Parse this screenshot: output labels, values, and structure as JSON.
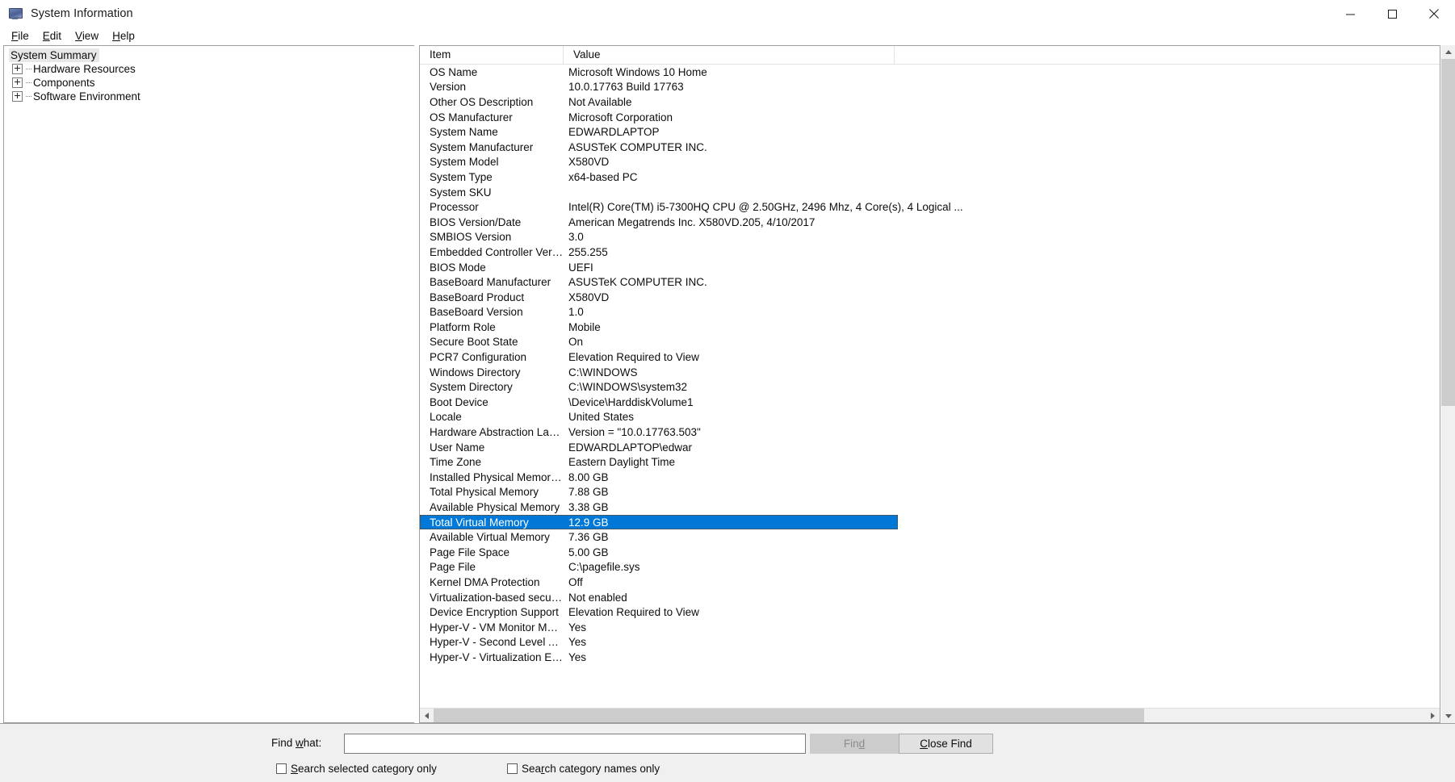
{
  "window": {
    "title": "System Information",
    "icon": "system-information-icon",
    "controls": {
      "minimize": "minimize-icon",
      "maximize": "maximize-icon",
      "close": "close-icon"
    }
  },
  "menubar": {
    "items": [
      {
        "label": "File",
        "accel": "F",
        "rest": "ile"
      },
      {
        "label": "Edit",
        "accel": "E",
        "rest": "dit"
      },
      {
        "label": "View",
        "accel": "V",
        "rest": "iew"
      },
      {
        "label": "Help",
        "accel": "H",
        "rest": "elp"
      }
    ]
  },
  "tree": {
    "selected": "System Summary",
    "nodes": [
      {
        "label": "System Summary",
        "expandable": false,
        "selected": true
      },
      {
        "label": "Hardware Resources",
        "expandable": true,
        "selected": false
      },
      {
        "label": "Components",
        "expandable": true,
        "selected": false
      },
      {
        "label": "Software Environment",
        "expandable": true,
        "selected": false
      }
    ]
  },
  "list": {
    "columns": [
      "Item",
      "Value"
    ],
    "selected_index": 30,
    "rows": [
      {
        "item": "OS Name",
        "value": "Microsoft Windows 10 Home"
      },
      {
        "item": "Version",
        "value": "10.0.17763 Build 17763"
      },
      {
        "item": "Other OS Description",
        "value": "Not Available"
      },
      {
        "item": "OS Manufacturer",
        "value": "Microsoft Corporation"
      },
      {
        "item": "System Name",
        "value": "EDWARDLAPTOP"
      },
      {
        "item": "System Manufacturer",
        "value": "ASUSTeK COMPUTER INC."
      },
      {
        "item": "System Model",
        "value": "X580VD"
      },
      {
        "item": "System Type",
        "value": "x64-based PC"
      },
      {
        "item": "System SKU",
        "value": ""
      },
      {
        "item": "Processor",
        "value": "Intel(R) Core(TM) i5-7300HQ CPU @ 2.50GHz, 2496 Mhz, 4 Core(s), 4 Logical ..."
      },
      {
        "item": "BIOS Version/Date",
        "value": "American Megatrends Inc. X580VD.205, 4/10/2017"
      },
      {
        "item": "SMBIOS Version",
        "value": "3.0"
      },
      {
        "item": "Embedded Controller Version",
        "value": "255.255"
      },
      {
        "item": "BIOS Mode",
        "value": "UEFI"
      },
      {
        "item": "BaseBoard Manufacturer",
        "value": "ASUSTeK COMPUTER INC."
      },
      {
        "item": "BaseBoard Product",
        "value": "X580VD"
      },
      {
        "item": "BaseBoard Version",
        "value": "1.0"
      },
      {
        "item": "Platform Role",
        "value": "Mobile"
      },
      {
        "item": "Secure Boot State",
        "value": "On"
      },
      {
        "item": "PCR7 Configuration",
        "value": "Elevation Required to View"
      },
      {
        "item": "Windows Directory",
        "value": "C:\\WINDOWS"
      },
      {
        "item": "System Directory",
        "value": "C:\\WINDOWS\\system32"
      },
      {
        "item": "Boot Device",
        "value": "\\Device\\HarddiskVolume1"
      },
      {
        "item": "Locale",
        "value": "United States"
      },
      {
        "item": "Hardware Abstraction Layer",
        "value": "Version = \"10.0.17763.503\""
      },
      {
        "item": "User Name",
        "value": "EDWARDLAPTOP\\edwar"
      },
      {
        "item": "Time Zone",
        "value": "Eastern Daylight Time"
      },
      {
        "item": "Installed Physical Memory (RAM)",
        "value": "8.00 GB"
      },
      {
        "item": "Total Physical Memory",
        "value": "7.88 GB"
      },
      {
        "item": "Available Physical Memory",
        "value": "3.38 GB"
      },
      {
        "item": "Total Virtual Memory",
        "value": "12.9 GB"
      },
      {
        "item": "Available Virtual Memory",
        "value": "7.36 GB"
      },
      {
        "item": "Page File Space",
        "value": "5.00 GB"
      },
      {
        "item": "Page File",
        "value": "C:\\pagefile.sys"
      },
      {
        "item": "Kernel DMA Protection",
        "value": "Off"
      },
      {
        "item": "Virtualization-based security",
        "value": "Not enabled"
      },
      {
        "item": "Device Encryption Support",
        "value": "Elevation Required to View"
      },
      {
        "item": "Hyper-V - VM Monitor Mode E...",
        "value": "Yes"
      },
      {
        "item": "Hyper-V - Second Level Addres...",
        "value": "Yes"
      },
      {
        "item": "Hyper-V - Virtualization Enable...",
        "value": "Yes"
      }
    ],
    "selected_row": {
      "item": "Installed Physical Memory (RAM)",
      "value": "8.00 GB"
    }
  },
  "find": {
    "label_prefix": "Find ",
    "label_accel": "w",
    "label_suffix": "hat:",
    "input_value": "",
    "input_placeholder": "",
    "find_button": {
      "prefix": "Fin",
      "accel": "d",
      "suffix": "",
      "disabled": true
    },
    "close_button": {
      "prefix": "",
      "accel": "C",
      "suffix": "lose Find",
      "disabled": false
    },
    "checkboxes": [
      {
        "prefix": "",
        "accel": "S",
        "suffix": "earch selected category only",
        "checked": false
      },
      {
        "prefix": "Sea",
        "accel": "r",
        "suffix": "ch category names only",
        "checked": false
      }
    ]
  },
  "colors": {
    "selection": "#0078d7",
    "window_bg": "#ffffff",
    "chrome_bg": "#f0f0f0",
    "border": "#a0a0a0"
  }
}
